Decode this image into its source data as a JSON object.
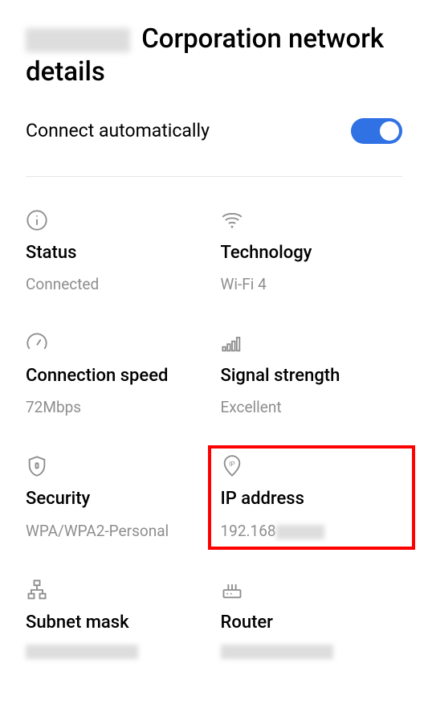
{
  "title_suffix": "Corporation network details",
  "toggle": {
    "label": "Connect automatically",
    "on": true
  },
  "items": {
    "status": {
      "label": "Status",
      "value": "Connected"
    },
    "technology": {
      "label": "Technology",
      "value": "Wi-Fi 4"
    },
    "connection_speed": {
      "label": "Connection speed",
      "value": "72Mbps"
    },
    "signal_strength": {
      "label": "Signal strength",
      "value": "Excellent"
    },
    "security": {
      "label": "Security",
      "value": "WPA/WPA2-Personal"
    },
    "ip_address": {
      "label": "IP address",
      "value_prefix": "192.168"
    },
    "subnet_mask": {
      "label": "Subnet mask"
    },
    "router": {
      "label": "Router"
    }
  }
}
